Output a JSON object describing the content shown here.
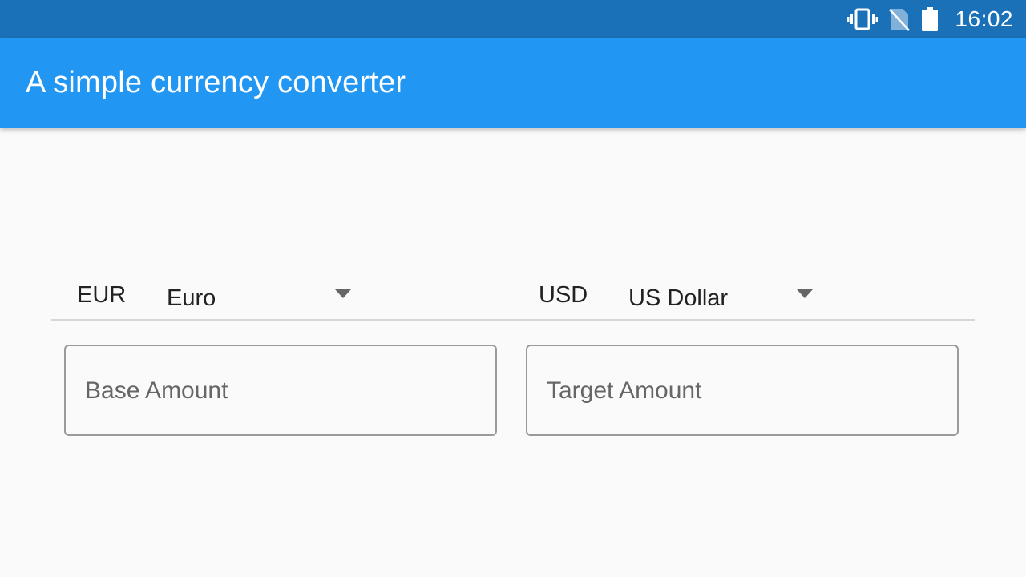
{
  "status_bar": {
    "time": "16:02",
    "icons": [
      "vibrate-icon",
      "no-sim-icon",
      "battery-icon"
    ]
  },
  "app_bar": {
    "title": "A simple currency converter",
    "color": "#2196f3"
  },
  "base_currency": {
    "code": "EUR",
    "selected": "Euro"
  },
  "target_currency": {
    "code": "USD",
    "selected": "US Dollar"
  },
  "fields": {
    "base_placeholder": "Base Amount",
    "base_value": "",
    "target_placeholder": "Target Amount",
    "target_value": ""
  }
}
